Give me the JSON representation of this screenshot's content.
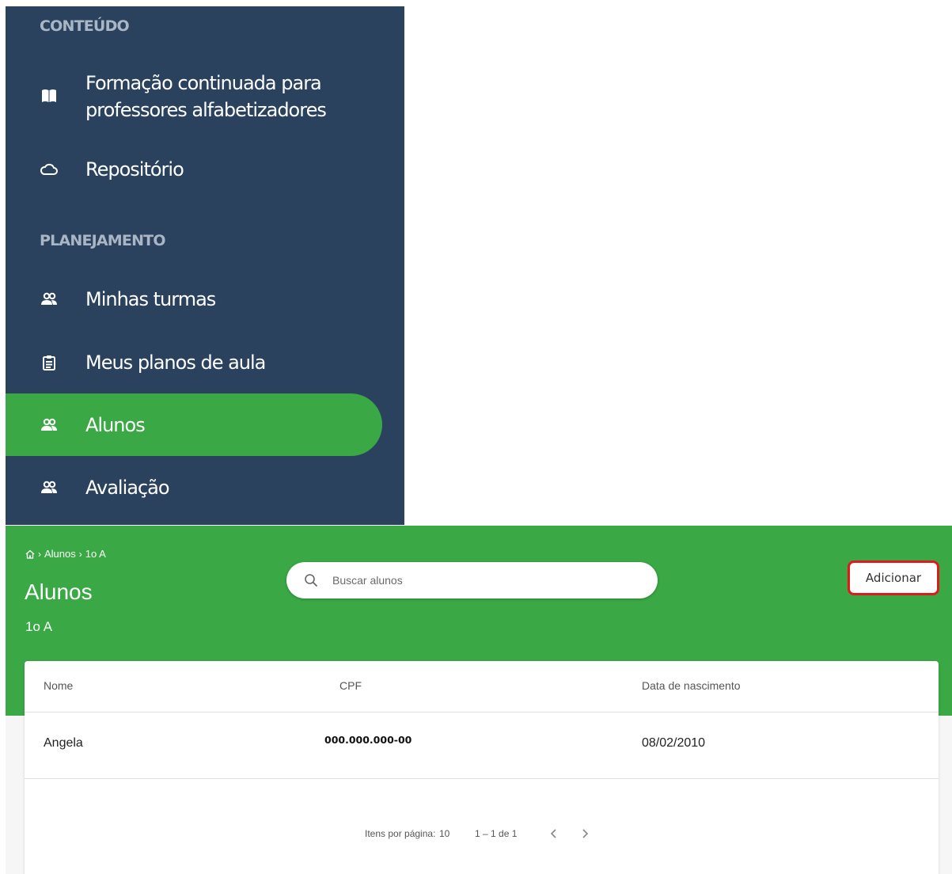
{
  "sidebar": {
    "sections": [
      {
        "title": "CONTEÚDO"
      },
      {
        "title": "PLANEJAMENTO"
      }
    ],
    "items": [
      {
        "label_line1": "Formação continuada para",
        "label_line2": "professores alfabetizadores",
        "icon": "book-icon"
      },
      {
        "label": "Repositório",
        "icon": "cloud-icon"
      },
      {
        "label": "Minhas turmas",
        "icon": "people-icon"
      },
      {
        "label": "Meus planos de aula",
        "icon": "clipboard-icon"
      },
      {
        "label": "Alunos",
        "icon": "people-icon",
        "active": true
      },
      {
        "label": "Avaliação",
        "icon": "people-icon"
      }
    ]
  },
  "header": {
    "breadcrumb": [
      "Alunos",
      "1o A"
    ],
    "title": "Alunos",
    "subtitle": "1o A",
    "search_placeholder": "Buscar alunos",
    "add_label": "Adicionar"
  },
  "table": {
    "columns": [
      "Nome",
      "CPF",
      "Data de nascimento"
    ],
    "rows": [
      {
        "nome": "Angela",
        "cpf": "000.000.000-00",
        "data": "08/02/2010"
      }
    ]
  },
  "paginator": {
    "items_per_page_label": "Itens por página:",
    "items_per_page": "10",
    "range": "1 – 1 de 1"
  },
  "colors": {
    "sidebar_bg": "#2b425e",
    "accent_green": "#3aa845",
    "highlight_red": "#e01a1a"
  }
}
